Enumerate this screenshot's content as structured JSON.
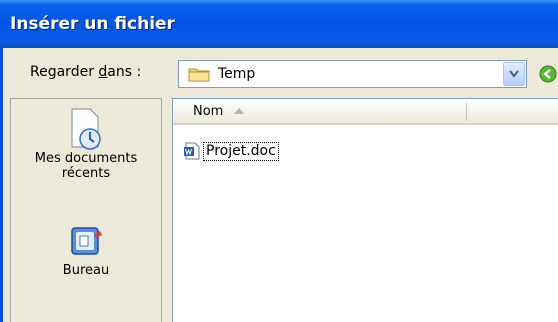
{
  "window": {
    "title": "Insérer un fichier"
  },
  "lookin": {
    "label_prefix": "Regarder ",
    "label_accel": "d",
    "label_suffix": "ans :",
    "value": "Temp"
  },
  "places": [
    {
      "label_line1": "Mes documents",
      "label_line2": "récents",
      "icon": "recent-documents-icon"
    },
    {
      "label_line1": "Bureau",
      "label_line2": "",
      "icon": "desktop-icon"
    }
  ],
  "columns": {
    "name": "Nom",
    "sort": "ascending"
  },
  "files": [
    {
      "name": "Projet.doc",
      "icon": "word-document-icon"
    }
  ],
  "colors": {
    "titlebar": "#0554e3",
    "dialog": "#ece9d8",
    "border": "#7f9db9"
  }
}
